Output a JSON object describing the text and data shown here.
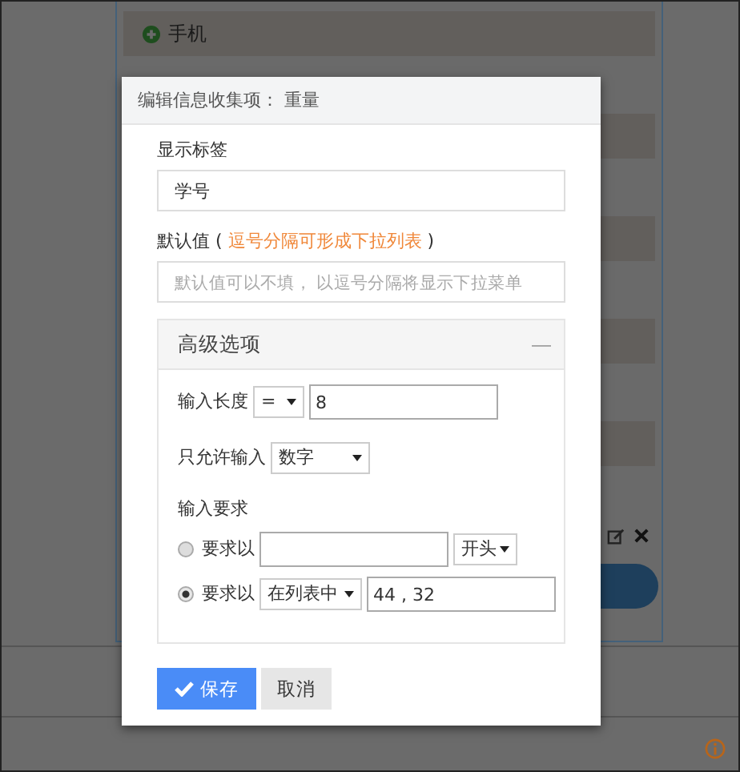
{
  "background": {
    "list_items": [
      {
        "label": "手机"
      }
    ]
  },
  "dialog": {
    "title": "编辑信息收集项： 重量",
    "label_field": {
      "label": "显示标签",
      "value": "学号"
    },
    "default_field": {
      "label_before": "默认值 (",
      "hint": "逗号分隔可形成下拉列表",
      "label_after": ")",
      "placeholder": "默认值可以不填， 以逗号分隔将显示下拉菜单"
    },
    "advanced": {
      "title": "高级选项",
      "toggle": "—",
      "length": {
        "label": "输入长度",
        "operator": "=",
        "value": "8"
      },
      "allow": {
        "label": "只允许输入",
        "value": "数字"
      },
      "requirement": {
        "label": "输入要求",
        "options": [
          {
            "label": "要求以",
            "selected": false,
            "kind": "text-first",
            "mode": "开头"
          },
          {
            "label": "要求以",
            "selected": true,
            "kind": "mode-first",
            "value": "44 , 32",
            "mode": "在列表中"
          }
        ]
      }
    },
    "buttons": [
      {
        "label": "保存",
        "kind": "primary"
      },
      {
        "label": "取消",
        "kind": "secondary"
      }
    ]
  }
}
